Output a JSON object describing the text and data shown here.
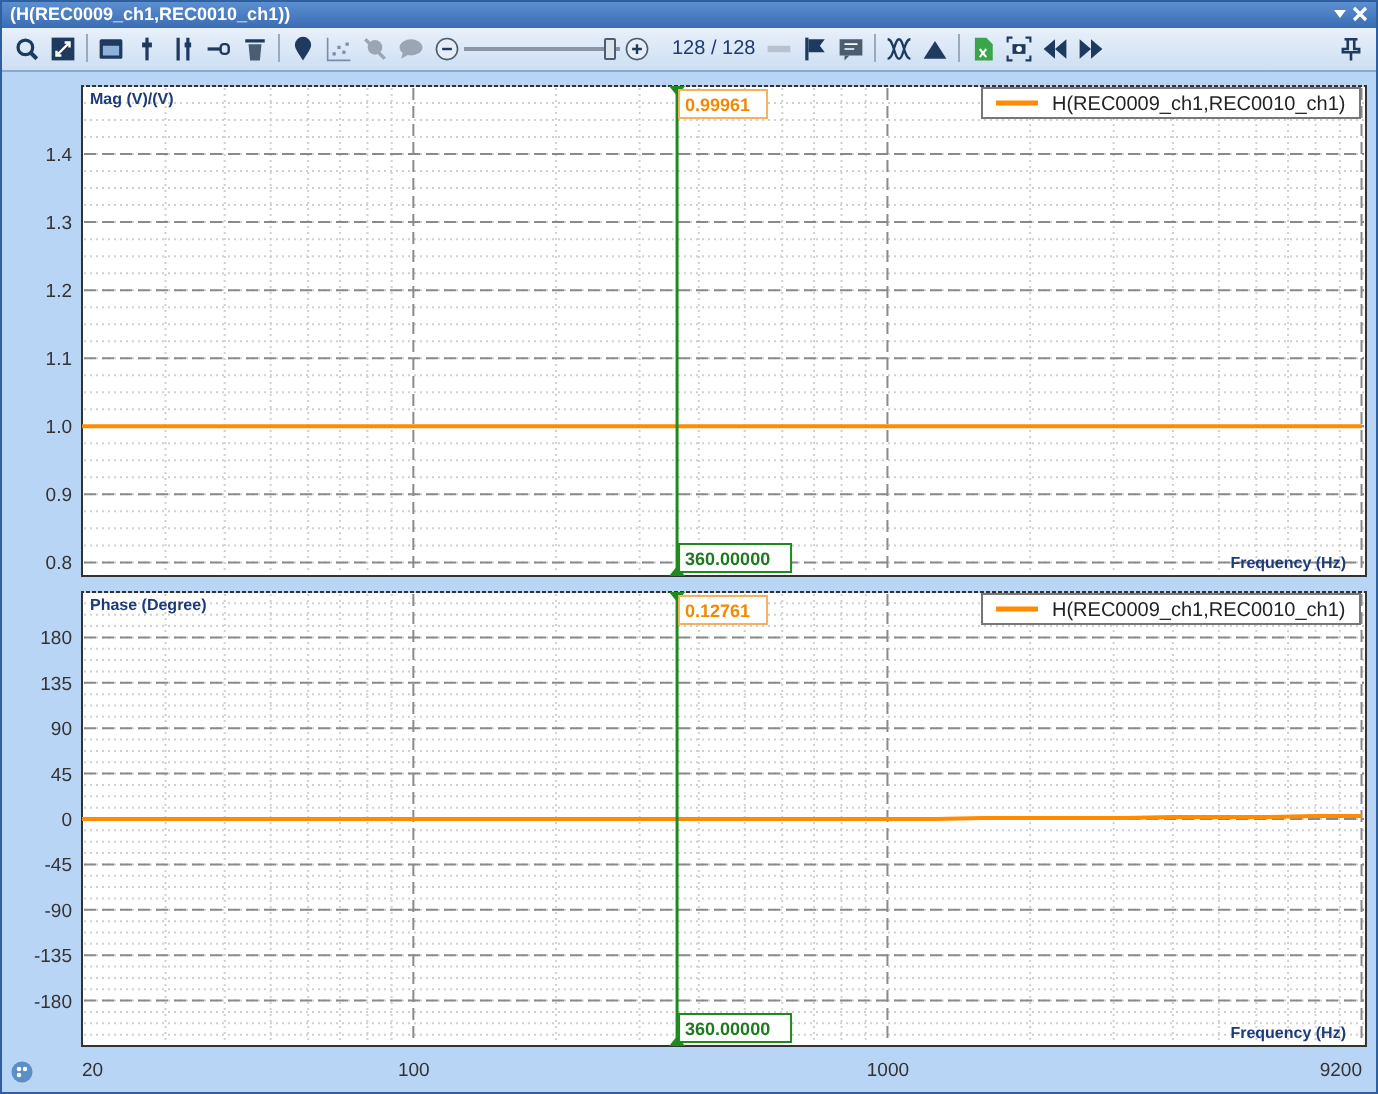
{
  "window": {
    "title": "(H(REC0009_ch1,REC0010_ch1))"
  },
  "toolbar": {
    "zoom_slider": {
      "level": 0.93
    },
    "page_counter": "128 / 128"
  },
  "charts": [
    {
      "cursor": {
        "value": "0.99961",
        "frequency": "360.00000"
      },
      "chart_data": {
        "type": "line",
        "ylabel": "Mag (V)/(V)",
        "xlabel": "Frequency (Hz)",
        "grid": true,
        "series": [
          {
            "name": "H(REC0009_ch1,REC0010_ch1)",
            "color": "#ff8c00",
            "values": [
              1.0,
              1.0,
              1.0,
              1.0,
              1.0,
              1.0,
              1.0,
              1.0,
              1.0,
              1.0,
              1.0,
              1.0,
              1.0,
              1.0,
              1.0,
              1.0,
              1.0,
              1.0,
              1.0,
              1.0,
              1.0,
              1.0,
              1.0,
              1.0,
              1.0,
              1.0,
              1.0,
              1.0
            ]
          }
        ],
        "ylim": [
          0.78,
          1.5
        ],
        "yticks": [
          {
            "value": 0.8,
            "label": "0.8"
          },
          {
            "value": 0.9,
            "label": "0.9"
          },
          {
            "value": 1.0,
            "label": "1.0"
          },
          {
            "value": 1.1,
            "label": "1.1"
          },
          {
            "value": 1.2,
            "label": "1.2"
          },
          {
            "value": 1.3,
            "label": "1.3"
          },
          {
            "value": 1.4,
            "label": "1.4"
          }
        ]
      }
    },
    {
      "cursor": {
        "value": "0.12761",
        "frequency": "360.00000"
      },
      "chart_data": {
        "type": "line",
        "ylabel": "Phase (Degree)",
        "xlabel": "Frequency (Hz)",
        "grid": true,
        "categories": [
          "20",
          null,
          null,
          null,
          null,
          null,
          null,
          "100",
          null,
          null,
          null,
          null,
          null,
          null,
          null,
          null,
          null,
          "1000",
          null,
          null,
          null,
          null,
          null,
          null,
          null,
          null,
          null,
          "9200"
        ],
        "series": [
          {
            "name": "H(REC0009_ch1,REC0010_ch1)",
            "color": "#ff8c00",
            "values": [
              0,
              0,
              0,
              0,
              0,
              0,
              0,
              0,
              0,
              0,
              0,
              0,
              0,
              0,
              0,
              0,
              0,
              0,
              0,
              1,
              1,
              1,
              1,
              2,
              2,
              2,
              3,
              3
            ]
          }
        ],
        "ylim": [
          -225,
          225
        ],
        "yticks": [
          180,
          135,
          90,
          45,
          0,
          -45,
          -90,
          -135,
          -180
        ]
      }
    }
  ]
}
